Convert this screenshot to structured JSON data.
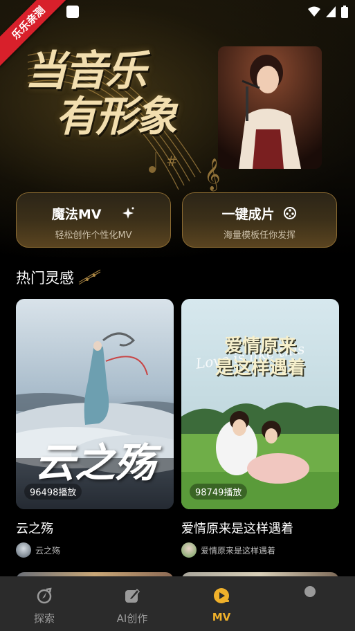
{
  "hero": {
    "badge": "乐乐亲测",
    "title_line1": "当音乐",
    "title_line2": "有形象"
  },
  "features": [
    {
      "title": "魔法MV",
      "subtitle": "轻松创作个性化MV",
      "icon": "sparkle-icon"
    },
    {
      "title": "一键成片",
      "subtitle": "海量模板任你发挥",
      "icon": "film-reel-icon"
    }
  ],
  "section": {
    "title": "热门灵感"
  },
  "cards": [
    {
      "cover_text": "云之殇",
      "plays": "96498播放",
      "title": "云之殇",
      "author": "云之殇"
    },
    {
      "cover_text_line1": "爱情原来",
      "cover_text_line2": "是这样遇着",
      "cover_script": "Love is like this",
      "plays": "98749播放",
      "title": "爱情原来是这样遇着",
      "author": "爱情原来是这样遇着"
    }
  ],
  "tabs": [
    {
      "label": "探索",
      "icon": "explore-icon",
      "active": false
    },
    {
      "label": "AI创作",
      "icon": "ai-create-icon",
      "active": false
    },
    {
      "label": "MV",
      "icon": "mv-play-icon",
      "active": true
    },
    {
      "label": "",
      "icon": "profile-icon",
      "active": false
    }
  ],
  "colors": {
    "accent": "#f0b12b",
    "badge": "#d8202b",
    "gold": "#f2deaf"
  }
}
